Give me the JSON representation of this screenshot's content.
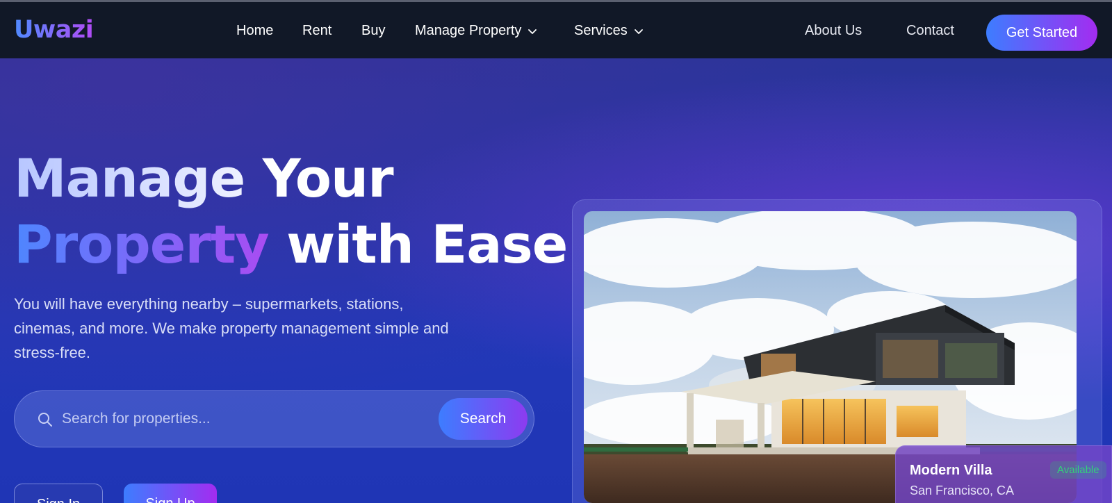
{
  "brand": {
    "logo_text": "Uwazi"
  },
  "nav": {
    "home": "Home",
    "rent": "Rent",
    "buy": "Buy",
    "manage_property": "Manage Property",
    "services": "Services",
    "about": "About Us",
    "contact": "Contact",
    "cta": "Get Started"
  },
  "hero": {
    "headline_line1_a": "Manage",
    "headline_line1_b": "Your",
    "headline_line2_a": "Property",
    "headline_line2_b": "with Ease",
    "description": "You will have everything nearby – supermarkets, stations, cinemas, and more. We make property management simple and stress-free.",
    "search_placeholder": "Search for properties...",
    "search_button": "Search",
    "signin_label": "Sign In",
    "signup_label": "Sign Up"
  },
  "featured": {
    "title": "Modern Villa",
    "location": "San Francisco, CA",
    "status": "Available"
  },
  "icons": {
    "search": "search-icon",
    "chevron": "chevron-down-icon"
  },
  "colors": {
    "nav_bg": "#111827",
    "accent_start": "#3d7dff",
    "accent_end": "#a32cf0",
    "available": "#33d17a"
  }
}
